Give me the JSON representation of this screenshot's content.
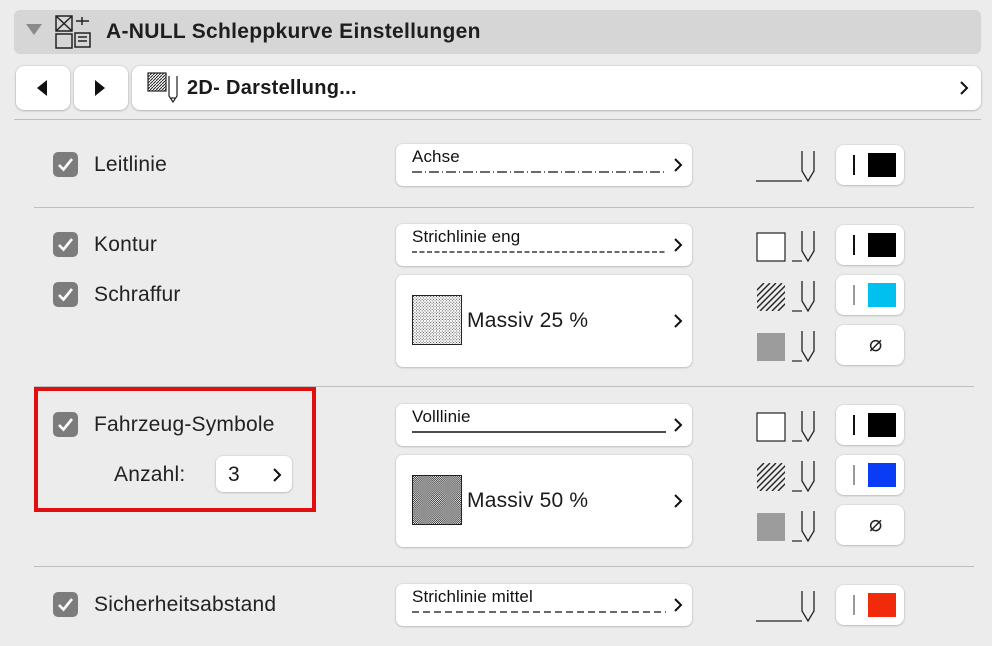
{
  "header": {
    "title": "A-NULL Schleppkurve Einstellungen"
  },
  "page": {
    "label": "2D- Darstellung..."
  },
  "rows": {
    "leitlinie": {
      "label": "Leitlinie",
      "checked": true,
      "line": "Achse",
      "pen_color": "#000000"
    },
    "kontur": {
      "label": "Kontur",
      "checked": true,
      "line": "Strichlinie eng",
      "pen_color": "#000000"
    },
    "schraffur": {
      "label": "Schraffur",
      "checked": true,
      "fill": "Massiv 25 %",
      "fg_color": "#00c0f0",
      "bg_symbol": "⌀"
    },
    "fahrzeug": {
      "label": "Fahrzeug-Symbole",
      "checked": true,
      "line": "Volllinie",
      "pen_color": "#000000"
    },
    "anzahl": {
      "label": "Anzahl:",
      "value": "3"
    },
    "fahrzeug_fill": {
      "fill": "Massiv 50 %",
      "fg_color": "#0a3cf5",
      "bg_symbol": "⌀"
    },
    "sicherheit": {
      "label": "Sicherheitsabstand",
      "checked": true,
      "line": "Strichlinie mittel",
      "pen_color": "#f02a0a"
    }
  },
  "colors": {
    "highlight": "#e01010",
    "checkbox": "#7c7c7c",
    "header_bg": "#d6d6d6"
  }
}
